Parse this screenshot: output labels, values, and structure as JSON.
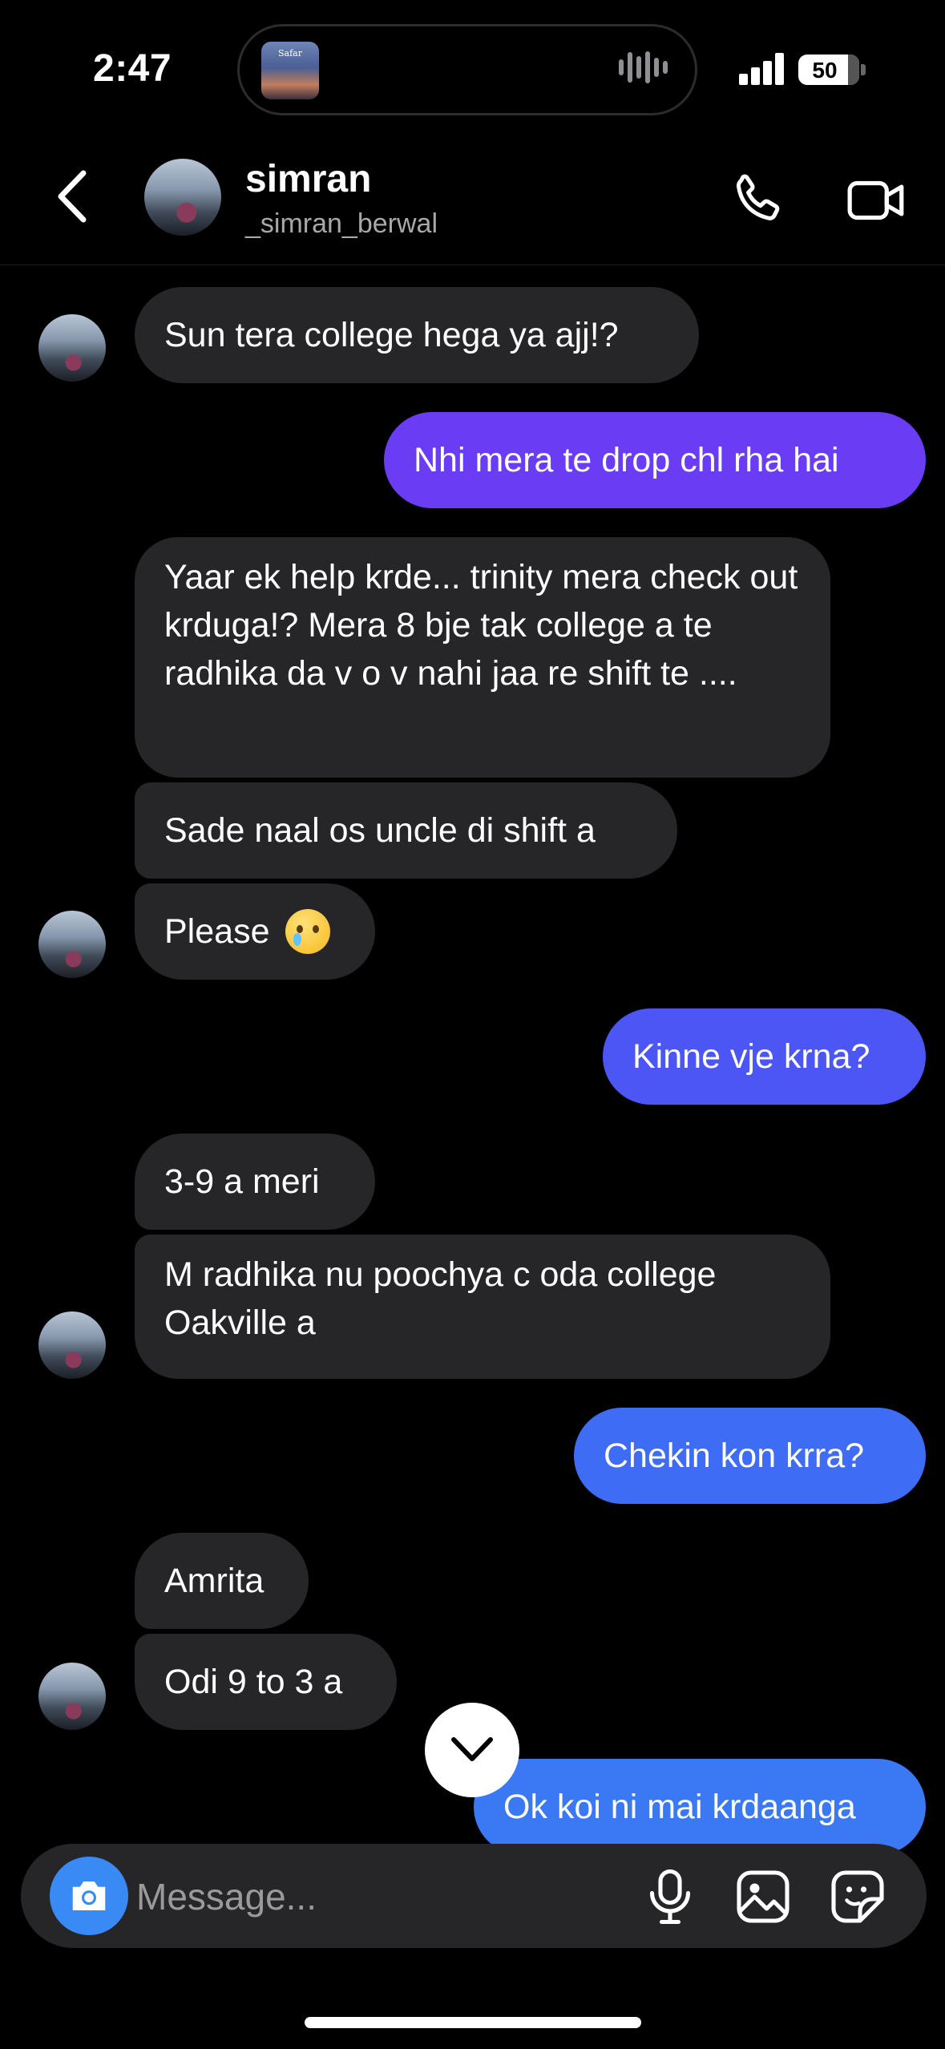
{
  "status_bar": {
    "time": "2:47",
    "battery": "50",
    "now_playing_art_label": "Safar"
  },
  "header": {
    "name": "simran",
    "handle": "_simran_berwal",
    "call_icon": "phone-icon",
    "video_icon": "video-camera-icon"
  },
  "messages": [
    {
      "from": "them",
      "text": "Sun tera college hega ya ajj!?"
    },
    {
      "from": "me",
      "text": "Nhi mera te drop chl rha hai"
    },
    {
      "from": "them",
      "text": "Yaar ek help krde... trinity mera check out krduga!? Mera 8 bje tak college a te radhika da v o v nahi jaa re shift te ...."
    },
    {
      "from": "them",
      "text": "Sade naal os uncle di shift a"
    },
    {
      "from": "them",
      "text": "Please",
      "emoji": "crying-face-emoji"
    },
    {
      "from": "me",
      "text": "Kinne vje krna?"
    },
    {
      "from": "them",
      "text": "3-9 a meri"
    },
    {
      "from": "them",
      "text": "M radhika nu poochya c oda college Oakville a"
    },
    {
      "from": "me",
      "text": "Chekin kon krra?"
    },
    {
      "from": "them",
      "text": "Amrita"
    },
    {
      "from": "them",
      "text": "Odi 9 to 3 a"
    },
    {
      "from": "me",
      "text": "Ok koi ni mai krdaanga"
    }
  ],
  "composer": {
    "placeholder": "Message..."
  },
  "colors": {
    "bubble_in": "#262628",
    "bubble_out_purple": "#6a3cf4",
    "bubble_out_blue": "#3f6cf4",
    "camera_button": "#3a8af6"
  }
}
